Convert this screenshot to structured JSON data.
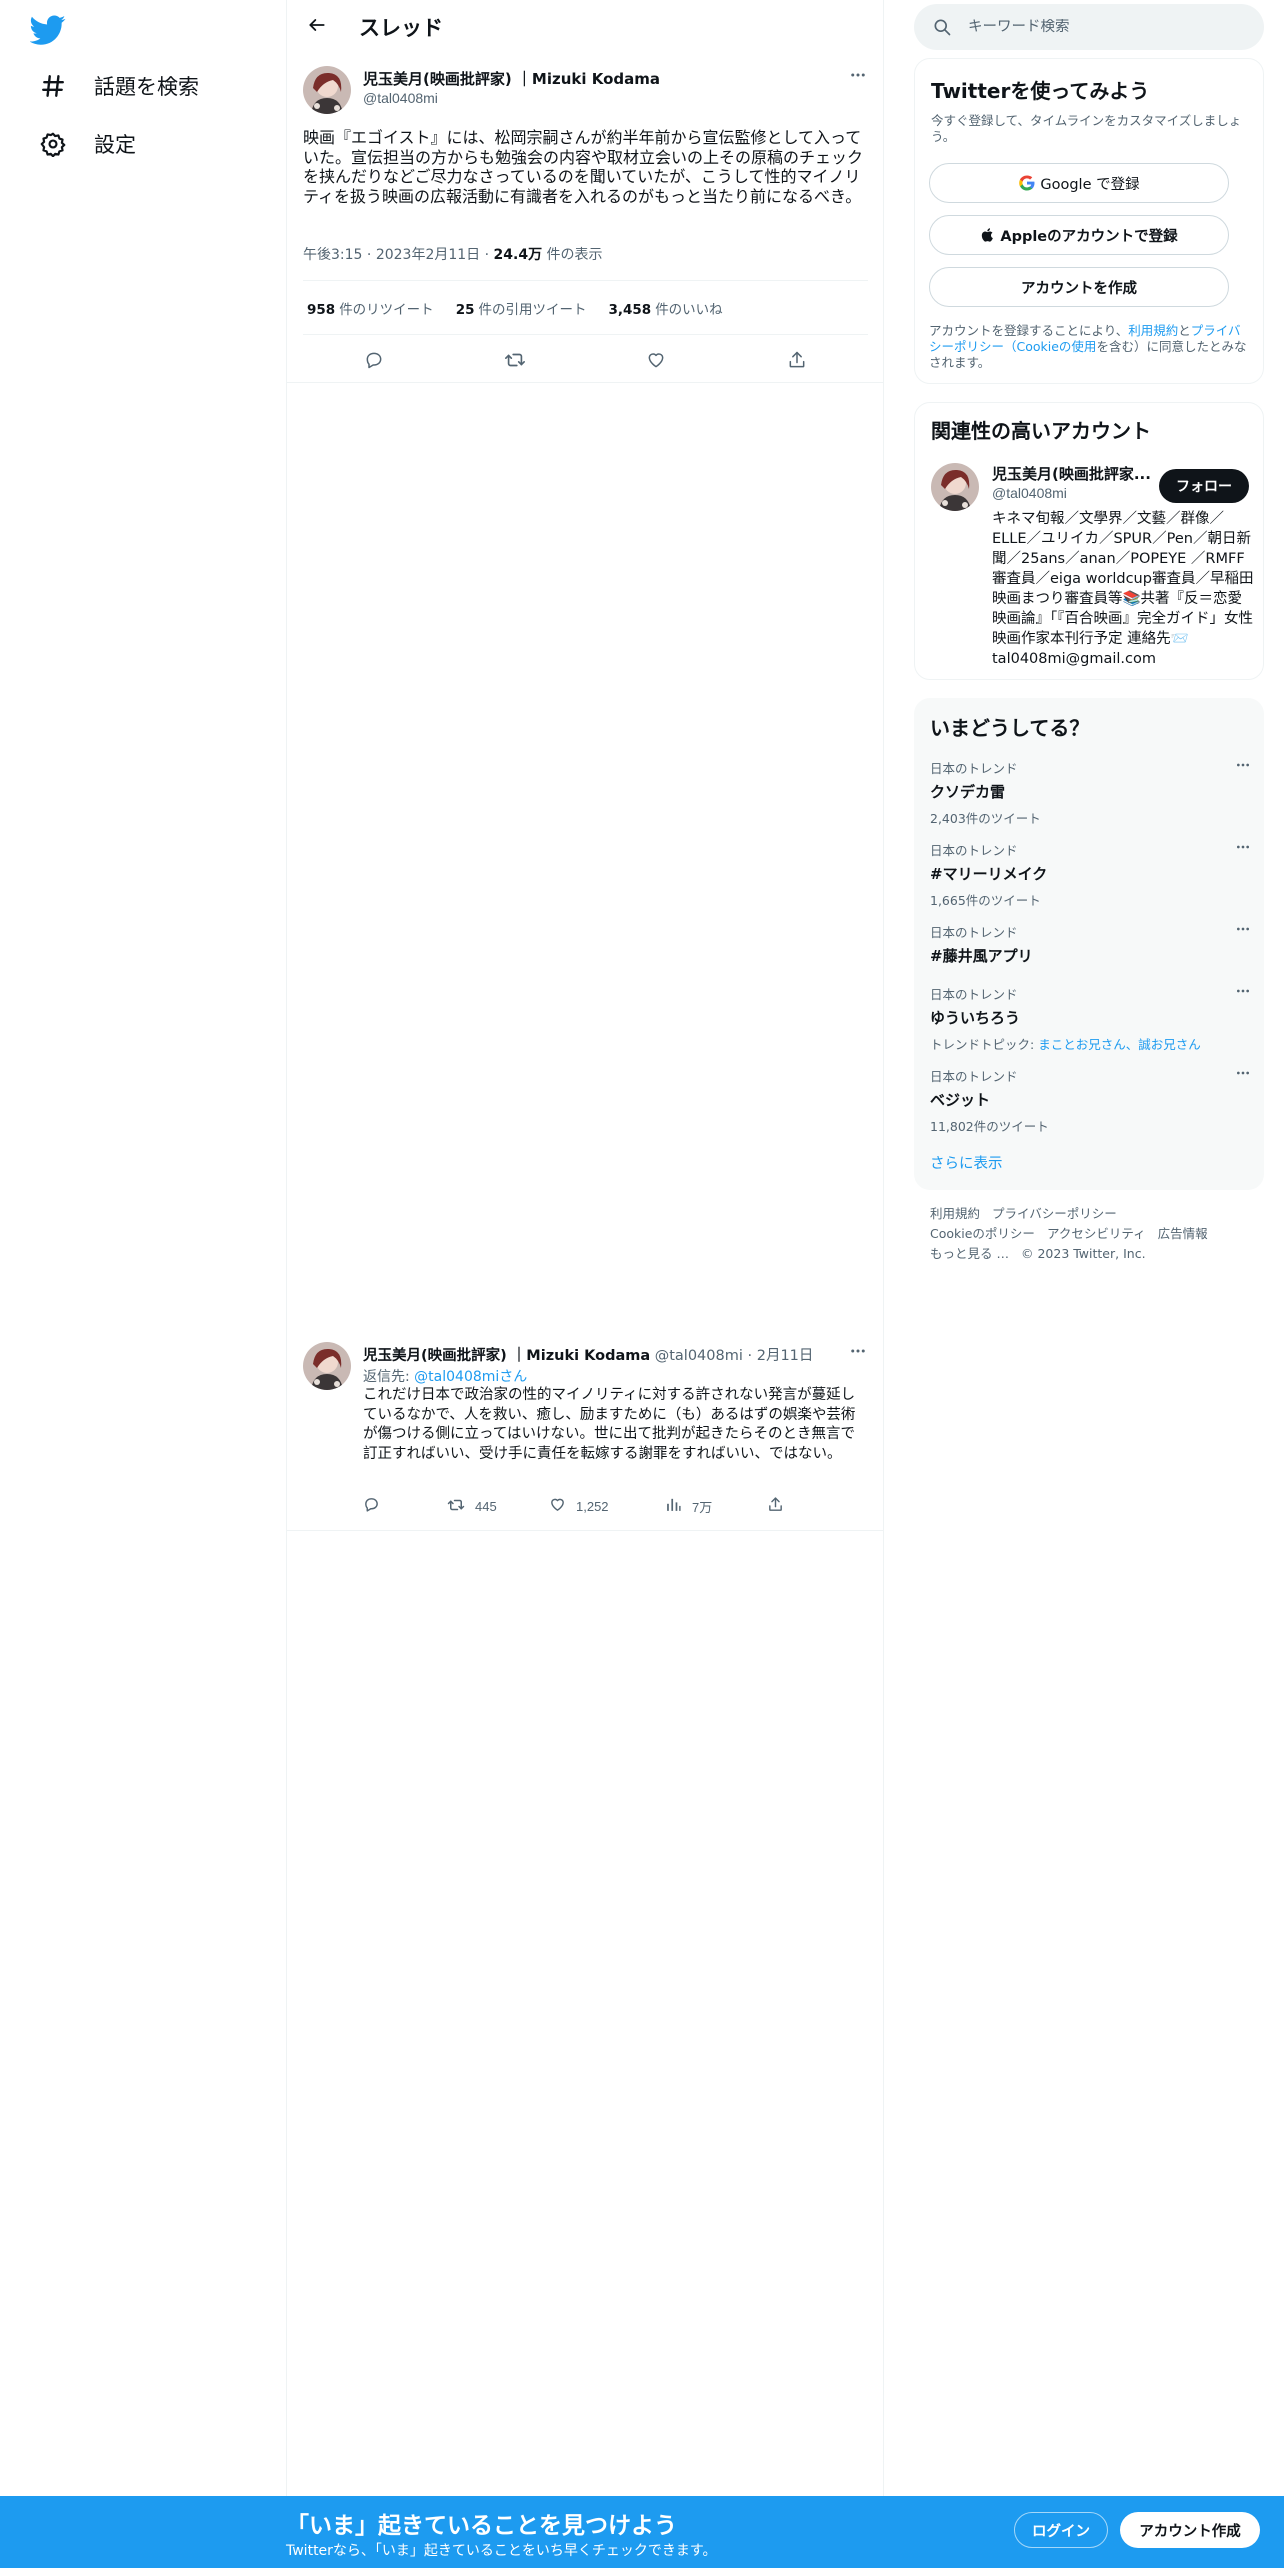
{
  "colors": {
    "accent": "#1d9bf0",
    "text": "#0f1419",
    "muted": "#536471",
    "border": "#eff3f4"
  },
  "sidebar": {
    "items": [
      {
        "icon": "hashtag-icon",
        "label": "話題を検索"
      },
      {
        "icon": "gear-icon",
        "label": "設定"
      }
    ]
  },
  "header": {
    "title": "スレッド"
  },
  "main_tweet": {
    "name": "児玉美月(映画批評家) ｜Mizuki Kodama",
    "handle": "@tal0408mi",
    "text": "映画『エゴイスト』には、松岡宗嗣さんが約半年前から宣伝監修として入っていた。宣伝担当の方からも勉強会の内容や取材立会いの上その原稿のチェックを挟んだりなどご尽力なさっているのを聞いていたが、こうして性的マイノリティを扱う映画の広報活動に有識者を入れるのがもっと当たり前になるべき。",
    "time": "午後3:15",
    "date": "2023年2月11日",
    "views": "24.4万",
    "views_label": "件の表示",
    "retweets": "958",
    "retweets_label": "件のリツイート",
    "quotes": "25",
    "quotes_label": "件の引用ツイート",
    "likes": "3,458",
    "likes_label": "件のいいね"
  },
  "reply_tweet": {
    "name": "児玉美月(映画批評家) ｜Mizuki Kodama",
    "handle": "@tal0408mi",
    "date": "2月11日",
    "reply_to_prefix": "返信先: ",
    "reply_to_handle": "@tal0408miさん",
    "text": "これだけ日本で政治家の性的マイノリティに対する許されない発言が蔓延しているなかで、人を救い、癒し、励ますために（も）あるはずの娯楽や芸術が傷つける側に立ってはいけない。世に出て批判が起きたらそのとき無言で訂正すればいい、受け手に責任を転嫁する謝罪をすればいい、ではない。",
    "retweets": "445",
    "likes": "1,252",
    "views": "7万"
  },
  "search": {
    "placeholder": "キーワード検索"
  },
  "signup": {
    "title": "Twitterを使ってみよう",
    "subtitle": "今すぐ登録して、タイムラインをカスタマイズしましょう。",
    "google_button": "Google で登録",
    "apple_button": "Appleのアカウントで登録",
    "create_button": "アカウントを作成",
    "terms_prefix": "アカウントを登録することにより、",
    "terms_link1": "利用規約",
    "terms_and": "と",
    "terms_link2": "プライバシーポリシー（Cookieの使用",
    "terms_suffix": "を含む）に同意したとみなされます。"
  },
  "related": {
    "title": "関連性の高いアカウント",
    "name": "児玉美月(映画批評家...",
    "handle": "@tal0408mi",
    "follow_button": "フォロー",
    "bio": "キネマ旬報／文學界／文藝／群像／ELLE／ユリイカ／SPUR／Pen／朝日新聞／25ans／anan／POPEYE ／RMFF審査員／eiga worldcup審査員／早稲田映画まつり審査員等📚共著『反＝恋愛映画論』「『百合映画』完全ガイド」女性映画作家本刊行予定 連絡先📨tal0408mi@gmail.com"
  },
  "trends": {
    "title": "いまどうしてる？",
    "items": [
      {
        "category": "日本のトレンド",
        "name": "クソデカ雷",
        "count": "2,403件のツイート"
      },
      {
        "category": "日本のトレンド",
        "name": "#マリーリメイク",
        "count": "1,665件のツイート"
      },
      {
        "category": "日本のトレンド",
        "name": "#藤井風アプリ",
        "count": ""
      },
      {
        "category": "日本のトレンド",
        "name": "ゆういちろう",
        "count_prefix": "トレンドトピック: ",
        "count_link": "まことお兄さん、誠お兄さん"
      },
      {
        "category": "日本のトレンド",
        "name": "ベジット",
        "count": "11,802件のツイート"
      }
    ],
    "show_more": "さらに表示"
  },
  "footer": {
    "links": [
      "利用規約",
      "プライバシーポリシー",
      "Cookieのポリシー",
      "アクセシビリティ",
      "広告情報",
      "もっと見る …",
      "© 2023 Twitter, Inc."
    ]
  },
  "banner": {
    "title": "「いま」起きていることを見つけよう",
    "subtitle": "Twitterなら、「いま」起きていることをいち早くチェックできます。",
    "login": "ログイン",
    "signup": "アカウント作成"
  }
}
